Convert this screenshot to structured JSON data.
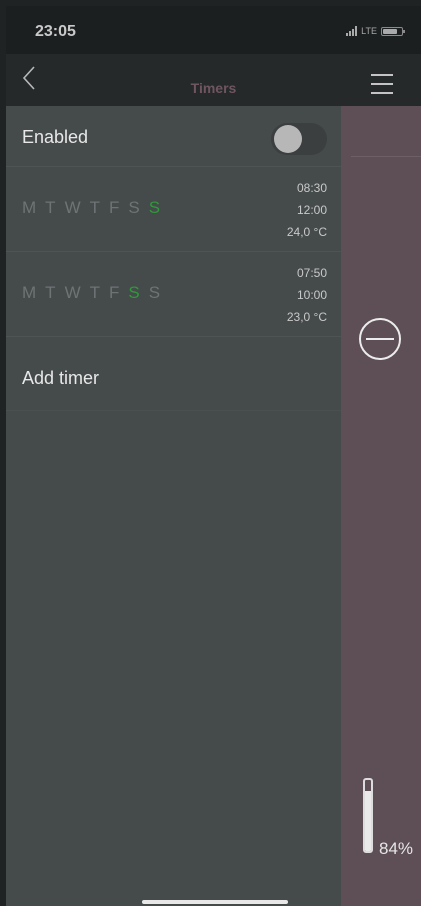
{
  "status": {
    "time": "23:05",
    "network": "LTE"
  },
  "nav": {
    "title": "Timers"
  },
  "settings": {
    "enabled_label": "Enabled",
    "enabled": false
  },
  "timers": [
    {
      "days": [
        "M",
        "T",
        "W",
        "T",
        "F",
        "S",
        "S"
      ],
      "active_days": [
        6
      ],
      "start": "08:30",
      "end": "12:00",
      "temp": "24,0 °C"
    },
    {
      "days": [
        "M",
        "T",
        "W",
        "T",
        "F",
        "S",
        "S"
      ],
      "active_days": [
        5
      ],
      "start": "07:50",
      "end": "10:00",
      "temp": "23,0 °C"
    }
  ],
  "add_timer_label": "Add timer",
  "side_panel": {
    "level_text": "84%",
    "level_fraction": 0.84
  },
  "colors": {
    "active_day": "#2f9a3a",
    "accent_title": "#6f5560",
    "side_panel": "#5d4f55"
  }
}
